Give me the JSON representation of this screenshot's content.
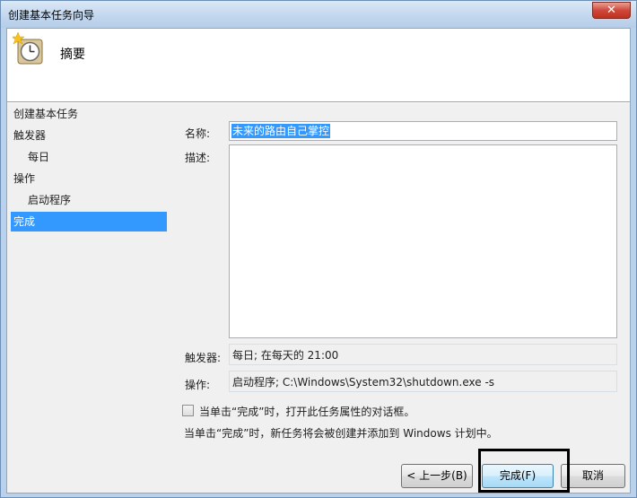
{
  "window": {
    "title": "创建基本任务向导",
    "close_glyph": "✕"
  },
  "header": {
    "title": "摘要",
    "icon": "clock-icon"
  },
  "steps": [
    {
      "label": "创建基本任务",
      "indent": false,
      "selected": false
    },
    {
      "label": "触发器",
      "indent": false,
      "selected": false
    },
    {
      "label": "每日",
      "indent": true,
      "selected": false
    },
    {
      "label": "操作",
      "indent": false,
      "selected": false
    },
    {
      "label": "启动程序",
      "indent": true,
      "selected": false
    },
    {
      "label": "完成",
      "indent": false,
      "selected": true
    }
  ],
  "form": {
    "name_label": "名称:",
    "name_value": "未来的路由自己掌控",
    "desc_label": "描述:",
    "desc_value": "",
    "trigger_label": "触发器:",
    "trigger_value": "每日; 在每天的 21:00",
    "action_label": "操作:",
    "action_value": "启动程序; C:\\Windows\\System32\\shutdown.exe -s",
    "checkbox_label": "当单击“完成”时，打开此任务属性的对话框。",
    "checkbox_checked": false,
    "info_text": "当单击“完成”时，新任务将会被创建并添加到 Windows 计划中。"
  },
  "buttons": {
    "back": "< 上一步(B)",
    "finish": "完成(F)",
    "cancel": "取消"
  },
  "colors": {
    "selection": "#3399ff",
    "panel": "#f0f0f0"
  }
}
